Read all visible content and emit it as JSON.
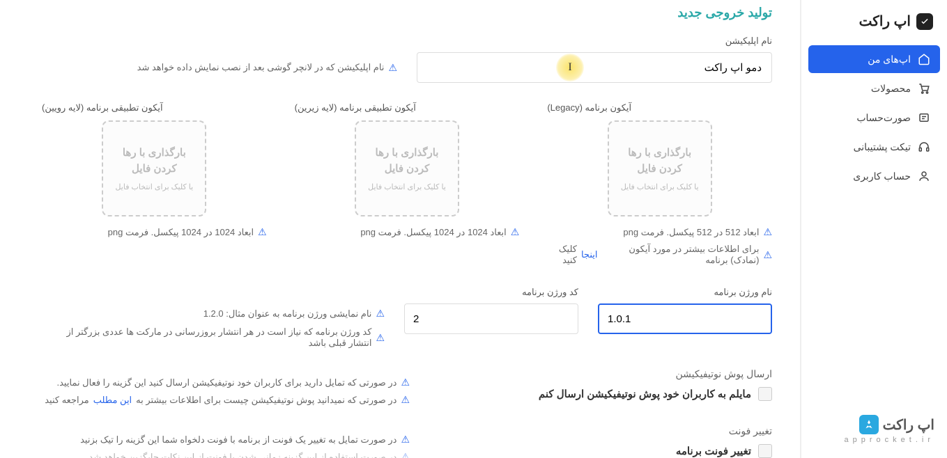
{
  "brand": {
    "name": "اپ راکت"
  },
  "sidebar": {
    "items": [
      {
        "label": "اپ‌های من",
        "icon": "home-icon",
        "active": true
      },
      {
        "label": "محصولات",
        "icon": "cart-icon"
      },
      {
        "label": "صورت‌حساب",
        "icon": "invoice-icon"
      },
      {
        "label": "تیکت پشتیبانی",
        "icon": "headset-icon"
      },
      {
        "label": "حساب کاربری",
        "icon": "user-icon"
      }
    ]
  },
  "footer": {
    "brand": "اپ راکت",
    "domain": "approcket.ir"
  },
  "page": {
    "title": "تولید خروجی جدید",
    "appName": {
      "label": "نام اپلیکیشن",
      "value": "دمو اپ راکت",
      "hint": "نام اپلیکیشن که در لانچر گوشی بعد از نصب نمایش داده خواهد شد"
    },
    "icons": {
      "legacy": {
        "label": "آیکون برنامه (Legacy)",
        "dzMain": "بارگذاری با رها کردن فایل",
        "dzSub": "یا کلیک برای انتخاب فایل",
        "hint": "ابعاد 512 در 512 پیکسل. فرمت png"
      },
      "background": {
        "label": "آیکون تطبیقی برنامه (لایه زیرین)",
        "dzMain": "بارگذاری با رها کردن فایل",
        "dzSub": "یا کلیک برای انتخاب فایل",
        "hint": "ابعاد 1024 در 1024 پیکسل. فرمت png"
      },
      "foreground": {
        "label": "آیکون تطبیقی برنامه (لایه رویین)",
        "dzMain": "بارگذاری با رها کردن فایل",
        "dzSub": "یا کلیک برای انتخاب فایل",
        "hint": "ابعاد 1024 در 1024 پیکسل. فرمت png"
      },
      "moreInfo": {
        "prefix": "برای اطلاعات بیشتر در مورد آیکون (نمادک) برنامه ",
        "link": "اینجا",
        "suffix": " کلیک کنید"
      }
    },
    "version": {
      "nameLabel": "نام ورژن برنامه",
      "nameValue": "1.0.1",
      "codeLabel": "کد ورژن برنامه",
      "codeValue": "2",
      "hint1": "نام نمایشی ورژن برنامه به عنوان مثال: 1.2.0",
      "hint2": "کد ورژن برنامه که نیاز است در هر انتشار بروزرسانی در مارکت ها عددی بزرگتر از انتشار قبلی باشد"
    },
    "push": {
      "title": "ارسال پوش نوتیفیکیشن",
      "checkboxLabel": "مایلم به کاربران خود پوش نوتیفیکیشن ارسال کنم",
      "hint1": "در صورتی که تمایل دارید برای کاربران خود نوتیفیکیشن ارسال کنید این گزینه را فعال نمایید.",
      "hint2Prefix": "در صورتی که نمیدانید پوش نوتیفیکیشن چیست برای اطلاعات بیشتر به ",
      "hint2Link": "این مطلب",
      "hint2Suffix": " مراجعه کنید"
    },
    "font": {
      "title": "تغییر فونت",
      "checkboxLabel": "تغییر فونت برنامه",
      "hint1": "در صورت تمایل به تغییر یک فونت از برنامه با فونت دلخواه شما این گزینه را تیک بزنید",
      "hint2": "در صورت استفاده از این گزینه زمانی شدن با فونت از این نکات جایگزین خواهد شد"
    }
  }
}
